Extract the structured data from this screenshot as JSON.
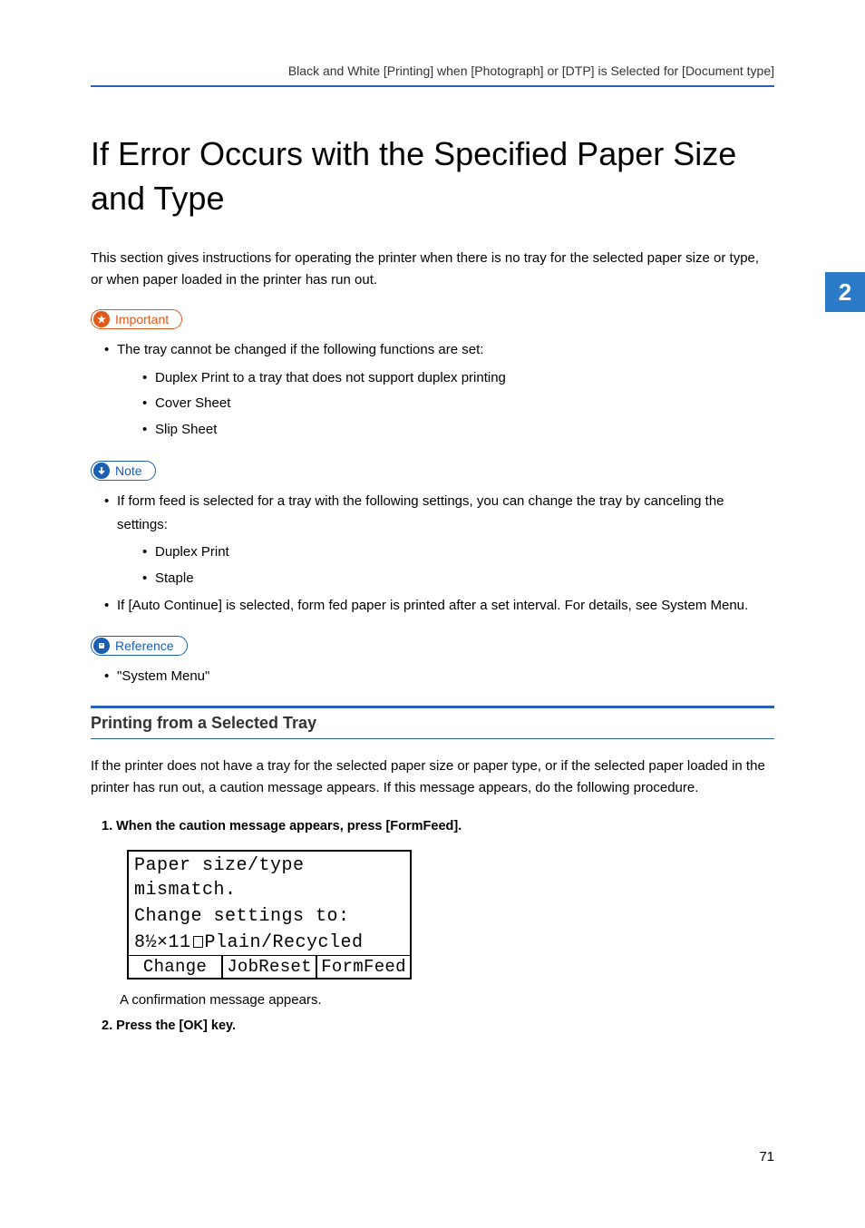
{
  "header": {
    "breadcrumb": "Black and White [Printing] when [Photograph] or [DTP] is Selected for [Document type]"
  },
  "side_tab": "2",
  "title": "If Error Occurs with the Specified Paper Size and Type",
  "intro": "This section gives instructions for operating the printer when there is no tray for the selected paper size or type, or when paper loaded in the printer has run out.",
  "important": {
    "label": "Important",
    "items": [
      {
        "text": "The tray cannot be changed if the following functions are set:",
        "sub": [
          "Duplex Print to a tray that does not support duplex printing",
          "Cover Sheet",
          "Slip Sheet"
        ]
      }
    ]
  },
  "note": {
    "label": "Note",
    "items": [
      {
        "text": "If form feed is selected for a tray with the following settings, you can change the tray by canceling the settings:",
        "sub": [
          "Duplex Print",
          "Staple"
        ]
      },
      {
        "text": "If [Auto Continue] is selected, form fed paper is printed after a set interval. For details, see System Menu.",
        "sub": []
      }
    ]
  },
  "reference": {
    "label": "Reference",
    "items": [
      "\"System Menu\""
    ]
  },
  "section": {
    "heading": "Printing from a Selected Tray",
    "intro": "If the printer does not have a tray for the selected paper size or paper type, or if the selected paper loaded in the printer has run out, a caution message appears. If this message appears, do the following procedure.",
    "steps": [
      {
        "num": "1.",
        "title": "When the caution message appears, press [FormFeed].",
        "lcd": {
          "line1": "Paper size/type mismatch.",
          "line2": "Change settings to:",
          "line3_prefix": "8½×11",
          "line3_suffix": "Plain/Recycled",
          "buttons": [
            "Change",
            "JobReset",
            "FormFeed"
          ]
        },
        "after": "A confirmation message appears."
      },
      {
        "num": "2.",
        "title": "Press the [OK] key."
      }
    ]
  },
  "page_number": "71"
}
